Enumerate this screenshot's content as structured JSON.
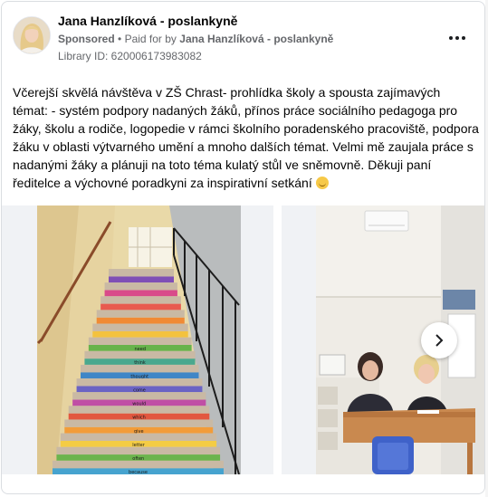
{
  "post": {
    "page_name": "Jana Hanzlíková - poslankyně",
    "sponsored_label": "Sponsored",
    "separator": "•",
    "paid_for_label": "Paid for by",
    "paid_for_name": "Jana Hanzlíková - poslankyně",
    "library_id": "Library ID: 620006173983082",
    "text": "Včerejší skvělá návštěva v ZŠ Chrast- prohlídka školy a spousta zajímavých témat: - systém podpory nadaných žáků, přínos práce sociálního pedagoga pro žáky, školu a rodiče, logopedie v rámci školního poradenského pracoviště, podpora žáku v oblasti výtvarného umění a mnoho dalších témat. Velmi mě zaujala práce s nadanými žáky a plánuji na toto téma kulatý stůl ve sněmovně. Děkuji paní ředitelce a výchovné poradkyni za inspirativní setkání",
    "emoji": "smiling-face-emoji"
  },
  "stair_words": [
    "need",
    "think",
    "thought",
    "come",
    "would",
    "which",
    "give",
    "letter",
    "often",
    "because"
  ],
  "icons": {
    "more": "more-options-icon",
    "next": "chevron-right-icon"
  }
}
